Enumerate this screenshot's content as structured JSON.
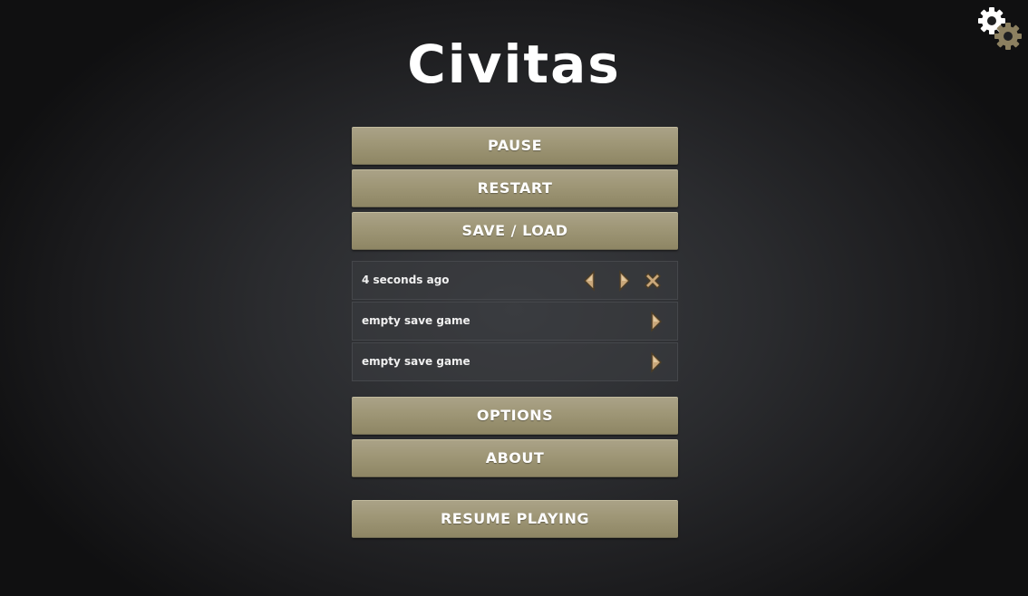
{
  "app": {
    "title": "Civitas"
  },
  "menu": {
    "pause_label": "PAUSE",
    "restart_label": "RESTART",
    "save_load_label": "SAVE / LOAD",
    "options_label": "OPTIONS",
    "about_label": "ABOUT",
    "resume_label": "RESUME PLAYING"
  },
  "save_slots": [
    {
      "label": "4 seconds ago",
      "icons": [
        "save-arrow-left-icon",
        "load-arrow-right-icon",
        "delete-x-icon"
      ]
    },
    {
      "label": "empty save game",
      "icons": [
        "save-arrow-right-icon"
      ]
    },
    {
      "label": "empty save game",
      "icons": [
        "save-arrow-right-icon"
      ]
    }
  ],
  "icons": {
    "settings": "gears-icon"
  },
  "colors": {
    "button_top": "#aaa287",
    "button_bottom": "#8e8664",
    "arrow_fill": "#c9a77a",
    "gear_white": "#ffffff",
    "gear_brown": "#8c8060"
  }
}
